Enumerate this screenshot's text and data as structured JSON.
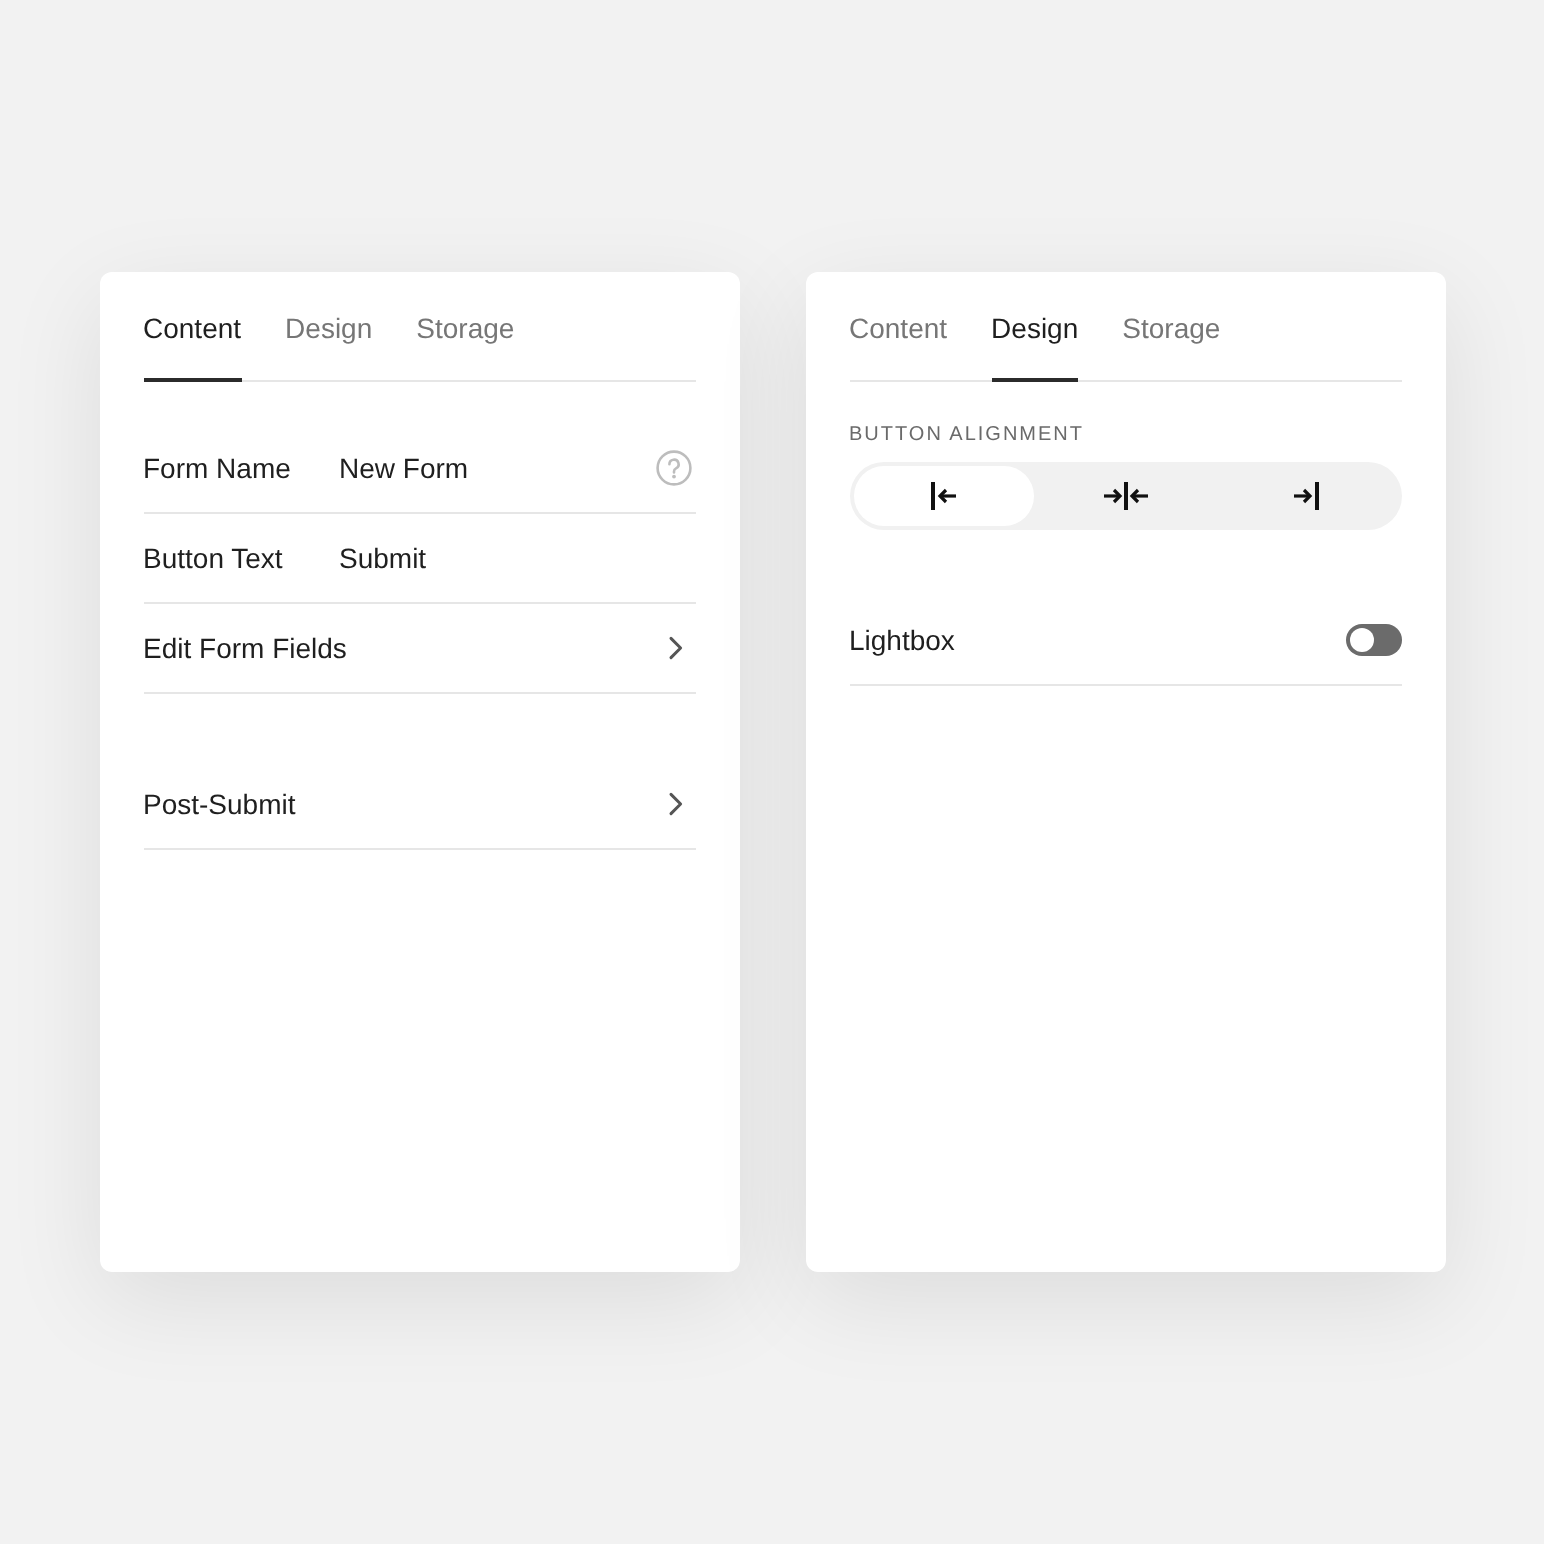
{
  "panels": [
    {
      "tabs": [
        {
          "label": "Content",
          "selected": true
        },
        {
          "label": "Design",
          "selected": false
        },
        {
          "label": "Storage",
          "selected": false
        }
      ],
      "sections": [
        {
          "kind": "rows",
          "rows": [
            {
              "kind": "field",
              "label": "Form Name",
              "value": "New Form",
              "help": true
            },
            {
              "kind": "field",
              "label": "Button Text",
              "value": "Submit",
              "help": false
            },
            {
              "kind": "link",
              "label": "Edit Form Fields"
            }
          ]
        },
        {
          "kind": "rows",
          "rows": [
            {
              "kind": "link",
              "label": "Post-Submit"
            }
          ]
        }
      ]
    },
    {
      "tabs": [
        {
          "label": "Content",
          "selected": false
        },
        {
          "label": "Design",
          "selected": true
        },
        {
          "label": "Storage",
          "selected": false
        }
      ],
      "sections": [
        {
          "kind": "segmented",
          "label": "BUTTON ALIGNMENT",
          "options": [
            {
              "kind": "left",
              "selected": true
            },
            {
              "kind": "center",
              "selected": false
            },
            {
              "kind": "right",
              "selected": false
            }
          ]
        },
        {
          "kind": "rows",
          "rows": [
            {
              "kind": "toggle",
              "label": "Lightbox",
              "on": false
            }
          ]
        }
      ]
    }
  ]
}
